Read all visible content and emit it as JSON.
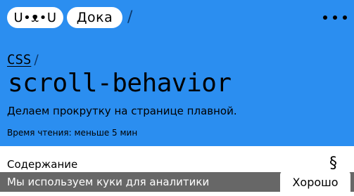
{
  "header": {
    "logo_text": "U•ᴥ•U",
    "section_label": "Дока",
    "breadcrumb_separator": "/",
    "menu_icon": "more-dots-icon"
  },
  "article": {
    "category": "CSS",
    "category_separator": "/",
    "title": "scroll-behavior",
    "subtitle": "Делаем прокрутку на странице плавной.",
    "reading_time": "Время чтения: меньше 5 мин"
  },
  "toc": {
    "label": "Содержание",
    "anchor_symbol": "§"
  },
  "cookie_banner": {
    "text": "Мы используем куки для аналитики",
    "accept_label": "Хорошо"
  },
  "colors": {
    "hero_background": "#2b8ef0",
    "banner_background": "rgba(60,60,60,0.78)"
  }
}
